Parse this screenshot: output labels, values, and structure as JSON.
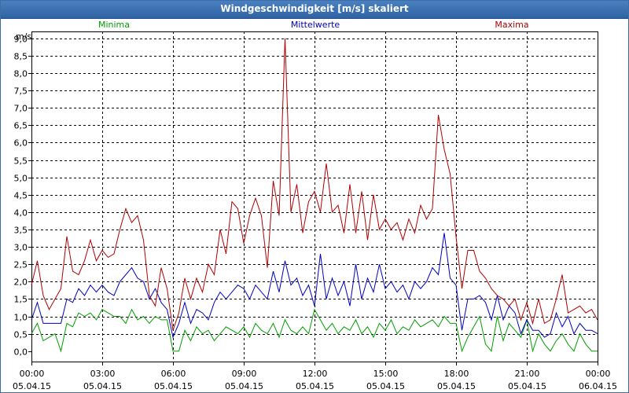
{
  "window": {
    "title": "Windgeschwindigkeit [m/s] skaliert"
  },
  "chart_data": {
    "type": "line",
    "title": "Windgeschwindigkeit [m/s] skaliert",
    "ylabel": "m/s",
    "xlabel": "",
    "ylim": [
      -0.3,
      9.2
    ],
    "xlim": [
      0,
      24
    ],
    "grid": true,
    "legend_position": "top",
    "y_ticks": [
      "0,0",
      "0,5",
      "1,0",
      "1,5",
      "2,0",
      "2,5",
      "3,0",
      "3,5",
      "4,0",
      "4,5",
      "5,0",
      "5,5",
      "6,0",
      "6,5",
      "7,0",
      "7,5",
      "8,0",
      "8,5",
      "9,0"
    ],
    "x_ticks": [
      {
        "time": "00:00",
        "date": "05.04.15"
      },
      {
        "time": "03:00",
        "date": "05.04.15"
      },
      {
        "time": "06:00",
        "date": "05.04.15"
      },
      {
        "time": "09:00",
        "date": "05.04.15"
      },
      {
        "time": "12:00",
        "date": "05.04.15"
      },
      {
        "time": "15:00",
        "date": "05.04.15"
      },
      {
        "time": "18:00",
        "date": "05.04.15"
      },
      {
        "time": "21:00",
        "date": "05.04.15"
      },
      {
        "time": "00:00",
        "date": "06.04.15"
      }
    ],
    "x_hours": [
      0,
      0.25,
      0.5,
      0.75,
      1,
      1.25,
      1.5,
      1.75,
      2,
      2.25,
      2.5,
      2.75,
      3,
      3.25,
      3.5,
      3.75,
      4,
      4.25,
      4.5,
      4.75,
      5,
      5.25,
      5.5,
      5.75,
      6,
      6.25,
      6.5,
      6.75,
      7,
      7.25,
      7.5,
      7.75,
      8,
      8.25,
      8.5,
      8.75,
      9,
      9.25,
      9.5,
      9.75,
      10,
      10.25,
      10.5,
      10.75,
      11,
      11.25,
      11.5,
      11.75,
      12,
      12.25,
      12.5,
      12.75,
      13,
      13.25,
      13.5,
      13.75,
      14,
      14.25,
      14.5,
      14.75,
      15,
      15.25,
      15.5,
      15.75,
      16,
      16.25,
      16.5,
      16.75,
      17,
      17.25,
      17.5,
      17.75,
      18,
      18.25,
      18.5,
      18.75,
      19,
      19.25,
      19.5,
      19.75,
      20,
      20.25,
      20.5,
      20.75,
      21,
      21.25,
      21.5,
      21.75,
      22,
      22.25,
      22.5,
      22.75,
      23,
      23.25,
      23.5,
      23.75,
      24
    ],
    "series": [
      {
        "name": "Minima",
        "color": "#00a000",
        "values": [
          0.5,
          0.8,
          0.3,
          0.4,
          0.5,
          0.0,
          0.8,
          0.7,
          1.1,
          1.0,
          1.1,
          0.9,
          1.2,
          1.1,
          1.0,
          1.0,
          0.8,
          1.2,
          0.9,
          1.0,
          0.8,
          1.0,
          0.9,
          0.9,
          0.0,
          0.0,
          0.6,
          0.3,
          0.7,
          0.5,
          0.6,
          0.3,
          0.5,
          0.7,
          0.6,
          0.5,
          0.7,
          0.4,
          0.8,
          0.6,
          0.5,
          0.8,
          0.4,
          0.9,
          0.6,
          0.5,
          0.7,
          0.5,
          1.2,
          0.9,
          0.6,
          0.8,
          0.5,
          0.7,
          0.6,
          0.9,
          0.5,
          0.7,
          0.4,
          0.8,
          0.6,
          0.9,
          0.5,
          0.7,
          0.6,
          0.9,
          0.7,
          0.8,
          0.9,
          0.7,
          1.0,
          0.8,
          0.8,
          0.0,
          0.4,
          0.7,
          1.0,
          0.2,
          0.0,
          1.0,
          0.3,
          0.8,
          0.6,
          0.4,
          0.9,
          0.0,
          0.5,
          0.2,
          0.0,
          0.3,
          0.5,
          0.2,
          0.0,
          0.5,
          0.2,
          0.0,
          0.0
        ]
      },
      {
        "name": "Mittelwerte",
        "color": "#0000c0",
        "values": [
          0.9,
          1.4,
          0.8,
          0.8,
          0.8,
          0.8,
          1.5,
          1.4,
          1.8,
          1.6,
          1.9,
          1.7,
          1.9,
          1.7,
          1.6,
          2.0,
          2.2,
          2.4,
          2.1,
          2.0,
          1.5,
          1.8,
          1.4,
          1.2,
          0.4,
          0.8,
          1.4,
          0.8,
          1.2,
          1.1,
          0.9,
          1.4,
          1.7,
          1.5,
          1.7,
          1.9,
          1.8,
          1.5,
          1.9,
          1.7,
          1.5,
          2.3,
          1.7,
          2.6,
          1.9,
          2.1,
          1.6,
          1.9,
          1.3,
          2.8,
          1.5,
          2.1,
          1.6,
          2.0,
          1.3,
          2.5,
          1.5,
          2.1,
          1.7,
          2.5,
          1.8,
          2.0,
          1.7,
          1.9,
          1.5,
          2.0,
          1.8,
          2.0,
          2.4,
          2.2,
          3.4,
          2.1,
          1.9,
          0.6,
          1.5,
          1.5,
          1.6,
          1.4,
          0.9,
          1.6,
          0.9,
          1.3,
          1.1,
          0.5,
          0.9,
          0.6,
          0.6,
          0.4,
          0.5,
          1.1,
          0.7,
          1.0,
          0.5,
          0.8,
          0.6,
          0.6,
          0.5
        ]
      },
      {
        "name": "Maxima",
        "color": "#b00000",
        "values": [
          1.9,
          2.6,
          1.6,
          1.2,
          1.5,
          1.8,
          3.3,
          2.3,
          2.2,
          2.6,
          3.2,
          2.6,
          2.9,
          2.7,
          2.8,
          3.5,
          4.1,
          3.7,
          3.9,
          3.2,
          1.6,
          1.3,
          2.4,
          1.8,
          0.6,
          1.1,
          2.1,
          1.5,
          2.1,
          1.7,
          2.5,
          2.2,
          3.5,
          2.8,
          4.3,
          4.1,
          3.1,
          3.9,
          4.4,
          3.9,
          2.4,
          4.9,
          3.9,
          9.0,
          4.0,
          4.8,
          3.4,
          4.3,
          4.6,
          4.0,
          5.4,
          4.0,
          4.2,
          3.4,
          4.8,
          3.4,
          4.6,
          3.2,
          4.5,
          3.5,
          3.8,
          3.5,
          3.7,
          3.2,
          3.8,
          3.4,
          4.2,
          3.8,
          4.1,
          6.8,
          5.8,
          5.1,
          3.3,
          1.8,
          2.9,
          2.9,
          2.3,
          2.1,
          1.8,
          1.6,
          1.5,
          1.3,
          1.5,
          0.9,
          1.4,
          0.8,
          1.5,
          0.8,
          0.9,
          1.5,
          2.2,
          1.1,
          1.2,
          1.3,
          1.1,
          1.2,
          0.9
        ]
      }
    ]
  }
}
